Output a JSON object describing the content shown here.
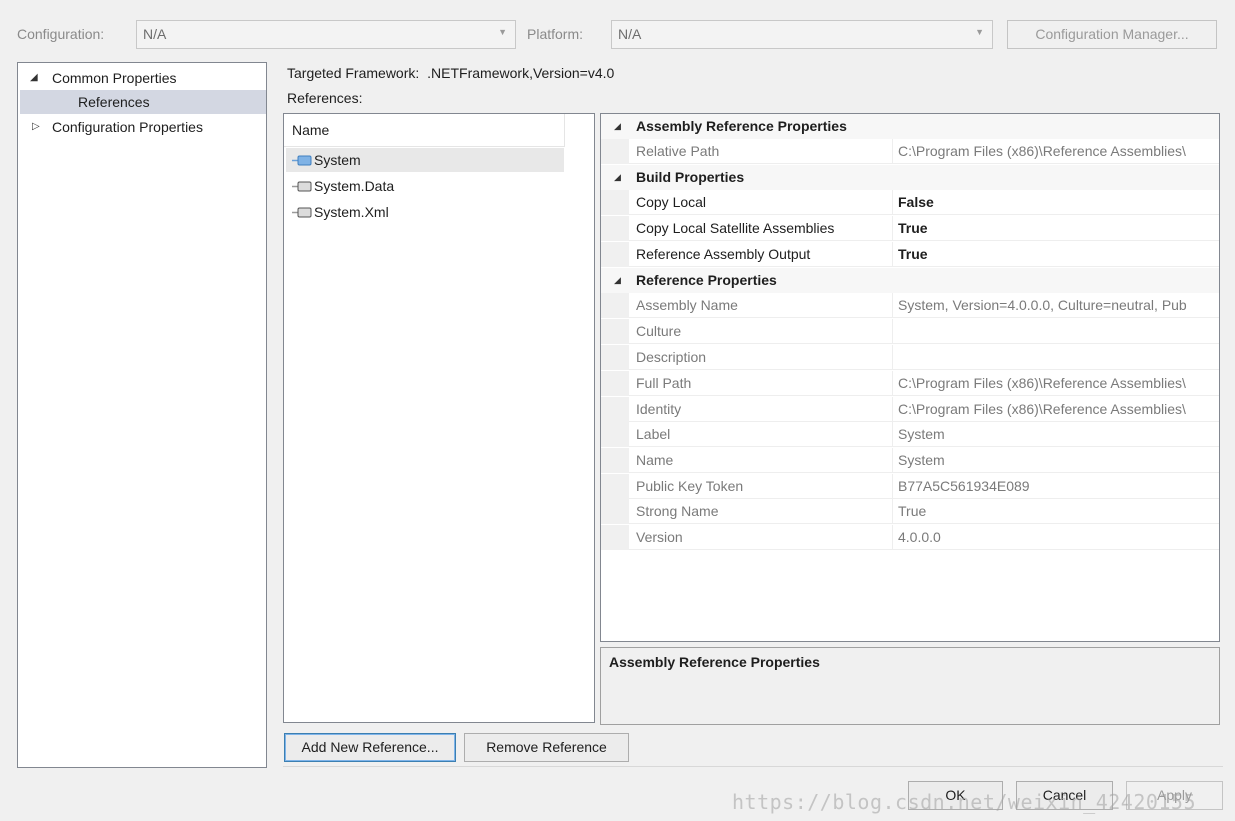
{
  "toolbar": {
    "configuration_label": "Configuration:",
    "configuration_value": "N/A",
    "platform_label": "Platform:",
    "platform_value": "N/A",
    "config_manager_button": "Configuration Manager..."
  },
  "tree": {
    "items": [
      {
        "label": "Common Properties",
        "expanded": true
      },
      {
        "label": "References",
        "selected": true
      },
      {
        "label": "Configuration Properties",
        "expanded": false
      }
    ]
  },
  "framework": {
    "label": "Targeted Framework:",
    "value": ".NETFramework,Version=v4.0"
  },
  "references": {
    "label": "References:",
    "column_header": "Name",
    "items": [
      "System",
      "System.Data",
      "System.Xml"
    ]
  },
  "property_grid": {
    "cat_assembly": "Assembly Reference Properties",
    "cat_build": "Build Properties",
    "cat_reference": "Reference Properties",
    "rows": [
      {
        "name": "Relative Path",
        "value": "C:\\Program Files (x86)\\Reference Assemblies\\"
      },
      {
        "name": "Copy Local",
        "value": "False"
      },
      {
        "name": "Copy Local Satellite Assemblies",
        "value": "True"
      },
      {
        "name": "Reference Assembly Output",
        "value": "True"
      },
      {
        "name": "Assembly Name",
        "value": "System, Version=4.0.0.0, Culture=neutral, Pub"
      },
      {
        "name": "Culture",
        "value": ""
      },
      {
        "name": "Description",
        "value": ""
      },
      {
        "name": "Full Path",
        "value": "C:\\Program Files (x86)\\Reference Assemblies\\"
      },
      {
        "name": "Identity",
        "value": "C:\\Program Files (x86)\\Reference Assemblies\\"
      },
      {
        "name": "Label",
        "value": "System"
      },
      {
        "name": "Name",
        "value": "System"
      },
      {
        "name": "Public Key Token",
        "value": "B77A5C561934E089"
      },
      {
        "name": "Strong Name",
        "value": "True"
      },
      {
        "name": "Version",
        "value": "4.0.0.0"
      }
    ],
    "description_title": "Assembly Reference Properties"
  },
  "buttons": {
    "add_reference": "Add New Reference...",
    "remove_reference": "Remove Reference",
    "ok": "OK",
    "cancel": "Cancel",
    "apply": "Apply"
  },
  "watermark": "https://blog.csdn.net/weixin_42420155",
  "colors": {
    "selection": "#d3d7e2",
    "window_bg": "#f0f0f0",
    "border": "#828790"
  },
  "icons": {
    "reference_item": "assembly-reference-icon",
    "expanded": "triangle-expanded-icon",
    "collapsed": "triangle-collapsed-icon"
  }
}
